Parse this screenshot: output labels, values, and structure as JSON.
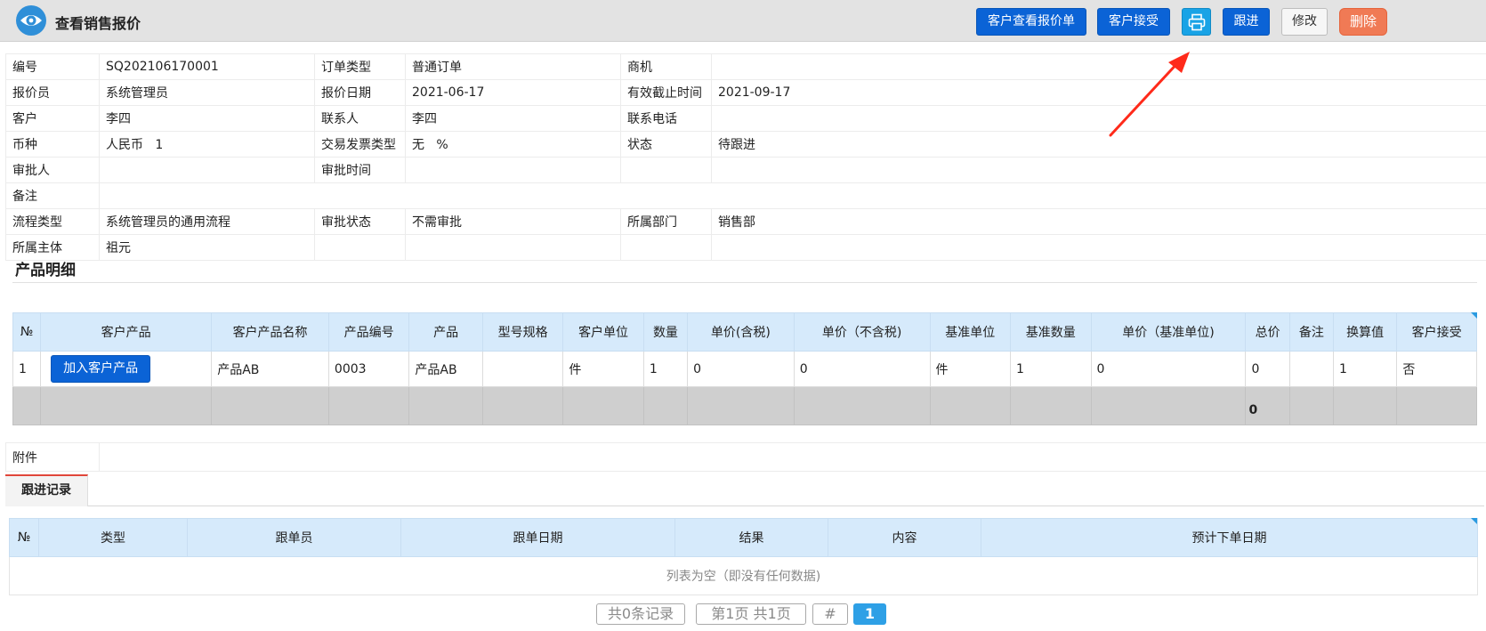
{
  "header": {
    "title": "查看销售报价",
    "buttons": {
      "customer_view": "客户查看报价单",
      "customer_accept": "客户接受",
      "follow": "跟进",
      "edit": "修改",
      "delete": "删除"
    }
  },
  "info": {
    "code_label": "编号",
    "code": "SQ202106170001",
    "order_type_label": "订单类型",
    "order_type": "普通订单",
    "opportunity_label": "商机",
    "opportunity": "",
    "quoter_label": "报价员",
    "quoter": "系统管理员",
    "quote_date_label": "报价日期",
    "quote_date": "2021-06-17",
    "deadline_label": "有效截止时间",
    "deadline": "2021-09-17",
    "customer_label": "客户",
    "customer": "李四",
    "contact_label": "联系人",
    "contact": "李四",
    "phone_label": "联系电话",
    "phone": "",
    "currency_label": "币种",
    "currency": "人民币   1",
    "invoice_type_label": "交易发票类型",
    "invoice_type": "无   %",
    "status_label": "状态",
    "status": "待跟进",
    "approver_label": "审批人",
    "approver": "",
    "approve_time_label": "审批时间",
    "approve_time": "",
    "remark_label": "备注",
    "remark": "",
    "process_type_label": "流程类型",
    "process_type": "系统管理员的通用流程",
    "approve_status_label": "审批状态",
    "approve_status": "不需审批",
    "department_label": "所属部门",
    "department": "销售部",
    "entity_label": "所属主体",
    "entity": "祖元"
  },
  "products": {
    "section_title": "产品明细",
    "headers": [
      "№",
      "客户产品",
      "客户产品名称",
      "产品编号",
      "产品",
      "型号规格",
      "客户单位",
      "数量",
      "单价(含税)",
      "单价（不含税)",
      "基准单位",
      "基准数量",
      "单价（基准单位)",
      "总价",
      "备注",
      "换算值",
      "客户接受"
    ],
    "add_button": "加入客户产品",
    "rows": [
      {
        "no": "1",
        "cust_name": "产品AB",
        "code": "0003",
        "product": "产品AB",
        "spec": "",
        "cust_unit": "件",
        "qty": "1",
        "price_tax": "0",
        "price_notax": "0",
        "base_unit": "件",
        "base_qty": "1",
        "base_price": "0",
        "total": "0",
        "remark": "",
        "ratio": "1",
        "accepted": "否"
      }
    ],
    "total_sum": "0"
  },
  "attachment": {
    "label": "附件",
    "value": ""
  },
  "tabs": {
    "follow_records": "跟进记录"
  },
  "follow": {
    "headers": [
      "№",
      "类型",
      "跟单员",
      "跟单日期",
      "结果",
      "内容",
      "预计下单日期"
    ],
    "empty_text": "列表为空（即没有任何数据)"
  },
  "pagination": {
    "total_records": "共0条记录",
    "page_info": "第1页 共1页",
    "hash": "#",
    "current": "1"
  },
  "colors": {
    "primary": "#0b63d6",
    "header_bg": "#e3e3e3",
    "table_head": "#d6eafb",
    "delete": "#f07a55",
    "tab_accent": "#e0463a",
    "annotation_arrow": "#ff2a1a"
  }
}
